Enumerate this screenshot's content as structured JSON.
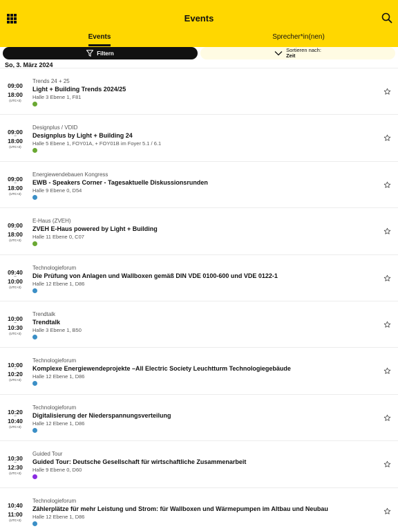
{
  "header": {
    "title": "Events",
    "menu_icon": "grid-menu-icon",
    "search_icon": "search-icon",
    "background": "#ffd700"
  },
  "tabs": [
    {
      "label": "Events",
      "selected": true
    },
    {
      "label": "Sprecher*in(nen)",
      "selected": false
    }
  ],
  "toolbar": {
    "filter_label": "Filtern",
    "sort_label": "Sortieren nach:",
    "sort_value": "Zeit"
  },
  "date_header": "So, 3. März 2024",
  "colors": {
    "green": "#6aa832",
    "blue": "#3b8fc6",
    "purple": "#8a2be2"
  },
  "events": [
    {
      "start": "09:00",
      "end": "18:00",
      "tz": "(UTC+2)",
      "category": "Trends 24 + 25",
      "title": "Light + Building Trends 2024/25",
      "location": "Halle 3 Ebene 1, F81",
      "dot_color": "#6aa832"
    },
    {
      "start": "09:00",
      "end": "18:00",
      "tz": "(UTC+2)",
      "category": "Designplus / VDID",
      "title": "Designplus by Light + Building 24",
      "location": "Halle 5 Ebene 1, FOY01A, + FOY01B im Foyer 5.1 / 6.1",
      "dot_color": "#6aa832"
    },
    {
      "start": "09:00",
      "end": "18:00",
      "tz": "(UTC+2)",
      "category": "Energiewendebauen Kongress",
      "title": "EWB - Speakers Corner - Tagesaktuelle Diskussionsrunden",
      "location": "Halle 9 Ebene 0, D54",
      "dot_color": "#3b8fc6"
    },
    {
      "start": "09:00",
      "end": "18:00",
      "tz": "(UTC+2)",
      "category": "E-Haus (ZVEH)",
      "title": "ZVEH E-Haus powered by Light + Building",
      "location": "Halle 11 Ebene 0, C07",
      "dot_color": "#6aa832"
    },
    {
      "start": "09:40",
      "end": "10:00",
      "tz": "(UTC+2)",
      "category": "Technologieforum",
      "title": "Die Prüfung von Anlagen und Wallboxen gemäß DIN VDE 0100-600 und VDE 0122-1",
      "location": "Halle 12 Ebene 1, D86",
      "dot_color": "#3b8fc6"
    },
    {
      "start": "10:00",
      "end": "10:30",
      "tz": "(UTC+2)",
      "category": "Trendtalk",
      "title": "Trendtalk",
      "location": "Halle 3 Ebene 1, B50",
      "dot_color": "#3b8fc6"
    },
    {
      "start": "10:00",
      "end": "10:20",
      "tz": "(UTC+2)",
      "category": "Technologieforum",
      "title": "Komplexe Energiewendeprojekte –All Electric Society Leuchtturm Technologiegebäude",
      "location": "Halle 12 Ebene 1, D86",
      "dot_color": "#3b8fc6"
    },
    {
      "start": "10:20",
      "end": "10:40",
      "tz": "(UTC+2)",
      "category": "Technologieforum",
      "title": "Digitalisierung der Niederspannungsverteilung",
      "location": "Halle 12 Ebene 1, D86",
      "dot_color": "#3b8fc6"
    },
    {
      "start": "10:30",
      "end": "12:30",
      "tz": "(UTC+2)",
      "category": "Guided Tour",
      "title": "Guided Tour: Deutsche Gesellschaft für wirtschaftliche Zusammenarbeit",
      "location": "Halle 9 Ebene 0, D60",
      "dot_color": "#8a2be2"
    },
    {
      "start": "10:40",
      "end": "11:00",
      "tz": "(UTC+2)",
      "category": "Technologieforum",
      "title": "Zählerplätze für mehr Leistung und Strom: für Wallboxen und Wärmepumpen im Altbau und Neubau",
      "location": "Halle 12 Ebene 1, D86",
      "dot_color": "#3b8fc6"
    }
  ]
}
